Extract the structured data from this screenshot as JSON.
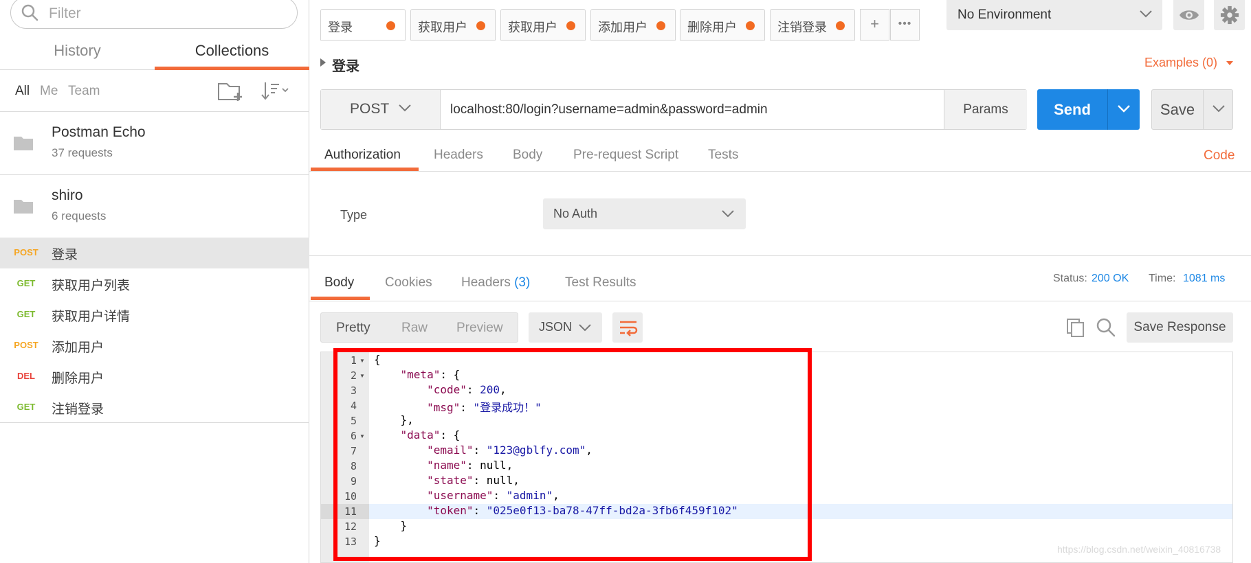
{
  "sidebar": {
    "filter_placeholder": "Filter",
    "tabs": [
      {
        "label": "History"
      },
      {
        "label": "Collections"
      }
    ],
    "scopes": [
      "All",
      "Me",
      "Team"
    ],
    "collections": [
      {
        "name": "Postman Echo",
        "count": "37 requests"
      },
      {
        "name": "shiro",
        "count": "6 requests"
      }
    ],
    "requests": [
      {
        "method": "POST",
        "name": "登录"
      },
      {
        "method": "GET",
        "name": "获取用户列表"
      },
      {
        "method": "GET",
        "name": "获取用户详情"
      },
      {
        "method": "POST",
        "name": "添加用户"
      },
      {
        "method": "DEL",
        "name": "删除用户"
      },
      {
        "method": "GET",
        "name": "注销登录"
      }
    ]
  },
  "tabs": [
    {
      "label": "登录"
    },
    {
      "label": "获取用户"
    },
    {
      "label": "获取用户"
    },
    {
      "label": "添加用户"
    },
    {
      "label": "删除用户"
    },
    {
      "label": "注销登录"
    }
  ],
  "tab_add": "+",
  "tab_more": "•••",
  "environment": "No Environment",
  "request": {
    "title": "登录",
    "examples": "Examples (0)",
    "method": "POST",
    "url": "localhost:80/login?username=admin&password=admin",
    "params": "Params",
    "send": "Send",
    "save": "Save",
    "tabs": [
      "Authorization",
      "Headers",
      "Body",
      "Pre-request Script",
      "Tests"
    ],
    "code_link": "Code",
    "auth_type_label": "Type",
    "auth_type_value": "No Auth"
  },
  "response": {
    "tabs": [
      "Body",
      "Cookies",
      "Headers",
      "Test Results"
    ],
    "headers_count": "(3)",
    "status_label": "Status:",
    "status_value": "200 OK",
    "time_label": "Time:",
    "time_value": "1081 ms",
    "views": [
      "Pretty",
      "Raw",
      "Preview"
    ],
    "format": "JSON",
    "save_response": "Save Response",
    "line_numbers": [
      "1",
      "2",
      "3",
      "4",
      "5",
      "6",
      "7",
      "8",
      "9",
      "10",
      "11",
      "12",
      "13"
    ],
    "lines": [
      "{",
      "    \"meta\": {",
      "        \"code\": 200,",
      "        \"msg\": \"登录成功！\"",
      "    },",
      "    \"data\": {",
      "        \"email\": \"123@gblfy.com\",",
      "        \"name\": null,",
      "        \"state\": null,",
      "        \"username\": \"admin\",",
      "        \"token\": \"025e0f13-ba78-47ff-bd2a-3fb6f459f102\"",
      "    }",
      "}"
    ]
  },
  "watermark": "https://blog.csdn.net/weixin_40816738",
  "colors": {
    "accent": "#f26b3a",
    "send": "#1e88e5",
    "post": "#f5a623",
    "get": "#7cba2e",
    "del": "#e8413a",
    "highlight": "#ff0000"
  }
}
